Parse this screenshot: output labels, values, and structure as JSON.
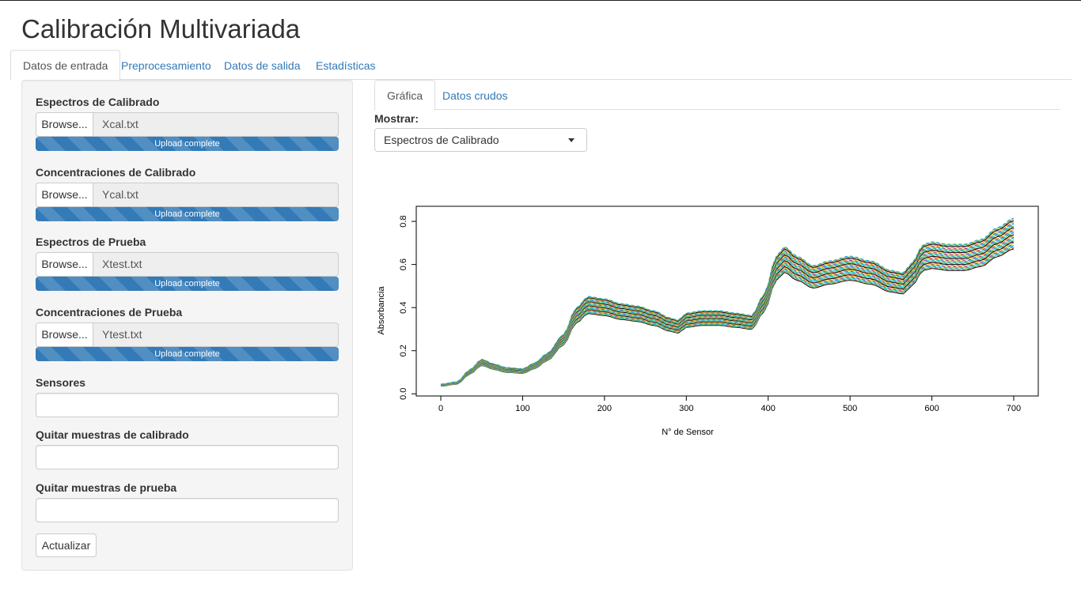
{
  "app": {
    "title": "Calibración Multivariada"
  },
  "main_tabs": [
    {
      "label": "Datos de entrada",
      "active": true
    },
    {
      "label": "Preprocesamiento",
      "active": false
    },
    {
      "label": "Datos de salida",
      "active": false
    },
    {
      "label": "Estadísticas",
      "active": false
    }
  ],
  "sidebar": {
    "uploads": [
      {
        "label": "Espectros de Calibrado",
        "button": "Browse...",
        "file": "Xcal.txt",
        "status": "Upload complete"
      },
      {
        "label": "Concentraciones de Calibrado",
        "button": "Browse...",
        "file": "Ycal.txt",
        "status": "Upload complete"
      },
      {
        "label": "Espectros de Prueba",
        "button": "Browse...",
        "file": "Xtest.txt",
        "status": "Upload complete"
      },
      {
        "label": "Concentraciones de Prueba",
        "button": "Browse...",
        "file": "Ytest.txt",
        "status": "Upload complete"
      }
    ],
    "inputs": [
      {
        "label": "Sensores",
        "value": ""
      },
      {
        "label": "Quitar muestras de calibrado",
        "value": ""
      },
      {
        "label": "Quitar muestras de prueba",
        "value": ""
      }
    ],
    "update_button": "Actualizar"
  },
  "sub_tabs": [
    {
      "label": "Gráfica",
      "active": true
    },
    {
      "label": "Datos crudos",
      "active": false
    }
  ],
  "mostrar": {
    "label": "Mostrar:",
    "selected": "Espectros de Calibrado"
  },
  "chart_data": {
    "type": "line",
    "title": "",
    "xlabel": "N° de Sensor",
    "ylabel": "Absorbancia",
    "xlim": [
      -30,
      730
    ],
    "ylim": [
      -0.01,
      0.87
    ],
    "xticks": [
      0,
      100,
      200,
      300,
      400,
      500,
      600,
      700
    ],
    "yticks": [
      0.0,
      0.2,
      0.4,
      0.6,
      0.8
    ],
    "grid": false,
    "legend": "none",
    "series_colors": [
      "#000000",
      "#DF536B",
      "#61D04F",
      "#2297E6",
      "#28E2E5",
      "#CD0BBC",
      "#F5C710",
      "#9E9E9E"
    ],
    "base_curve": {
      "x": [
        0,
        20,
        35,
        50,
        65,
        80,
        100,
        115,
        130,
        150,
        165,
        180,
        200,
        220,
        240,
        260,
        280,
        290,
        300,
        320,
        340,
        360,
        380,
        395,
        410,
        420,
        435,
        455,
        475,
        500,
        525,
        550,
        565,
        575,
        590,
        600,
        620,
        640,
        660,
        680,
        700
      ],
      "y": [
        0.04,
        0.05,
        0.1,
        0.145,
        0.125,
        0.11,
        0.105,
        0.13,
        0.17,
        0.25,
        0.36,
        0.41,
        0.4,
        0.38,
        0.37,
        0.35,
        0.32,
        0.31,
        0.34,
        0.35,
        0.35,
        0.34,
        0.33,
        0.42,
        0.58,
        0.62,
        0.58,
        0.54,
        0.56,
        0.58,
        0.56,
        0.52,
        0.51,
        0.55,
        0.63,
        0.64,
        0.63,
        0.63,
        0.65,
        0.7,
        0.74
      ]
    },
    "spread": [
      -0.09,
      0.1
    ],
    "n_series": 36,
    "x_range": [
      0,
      700
    ]
  }
}
